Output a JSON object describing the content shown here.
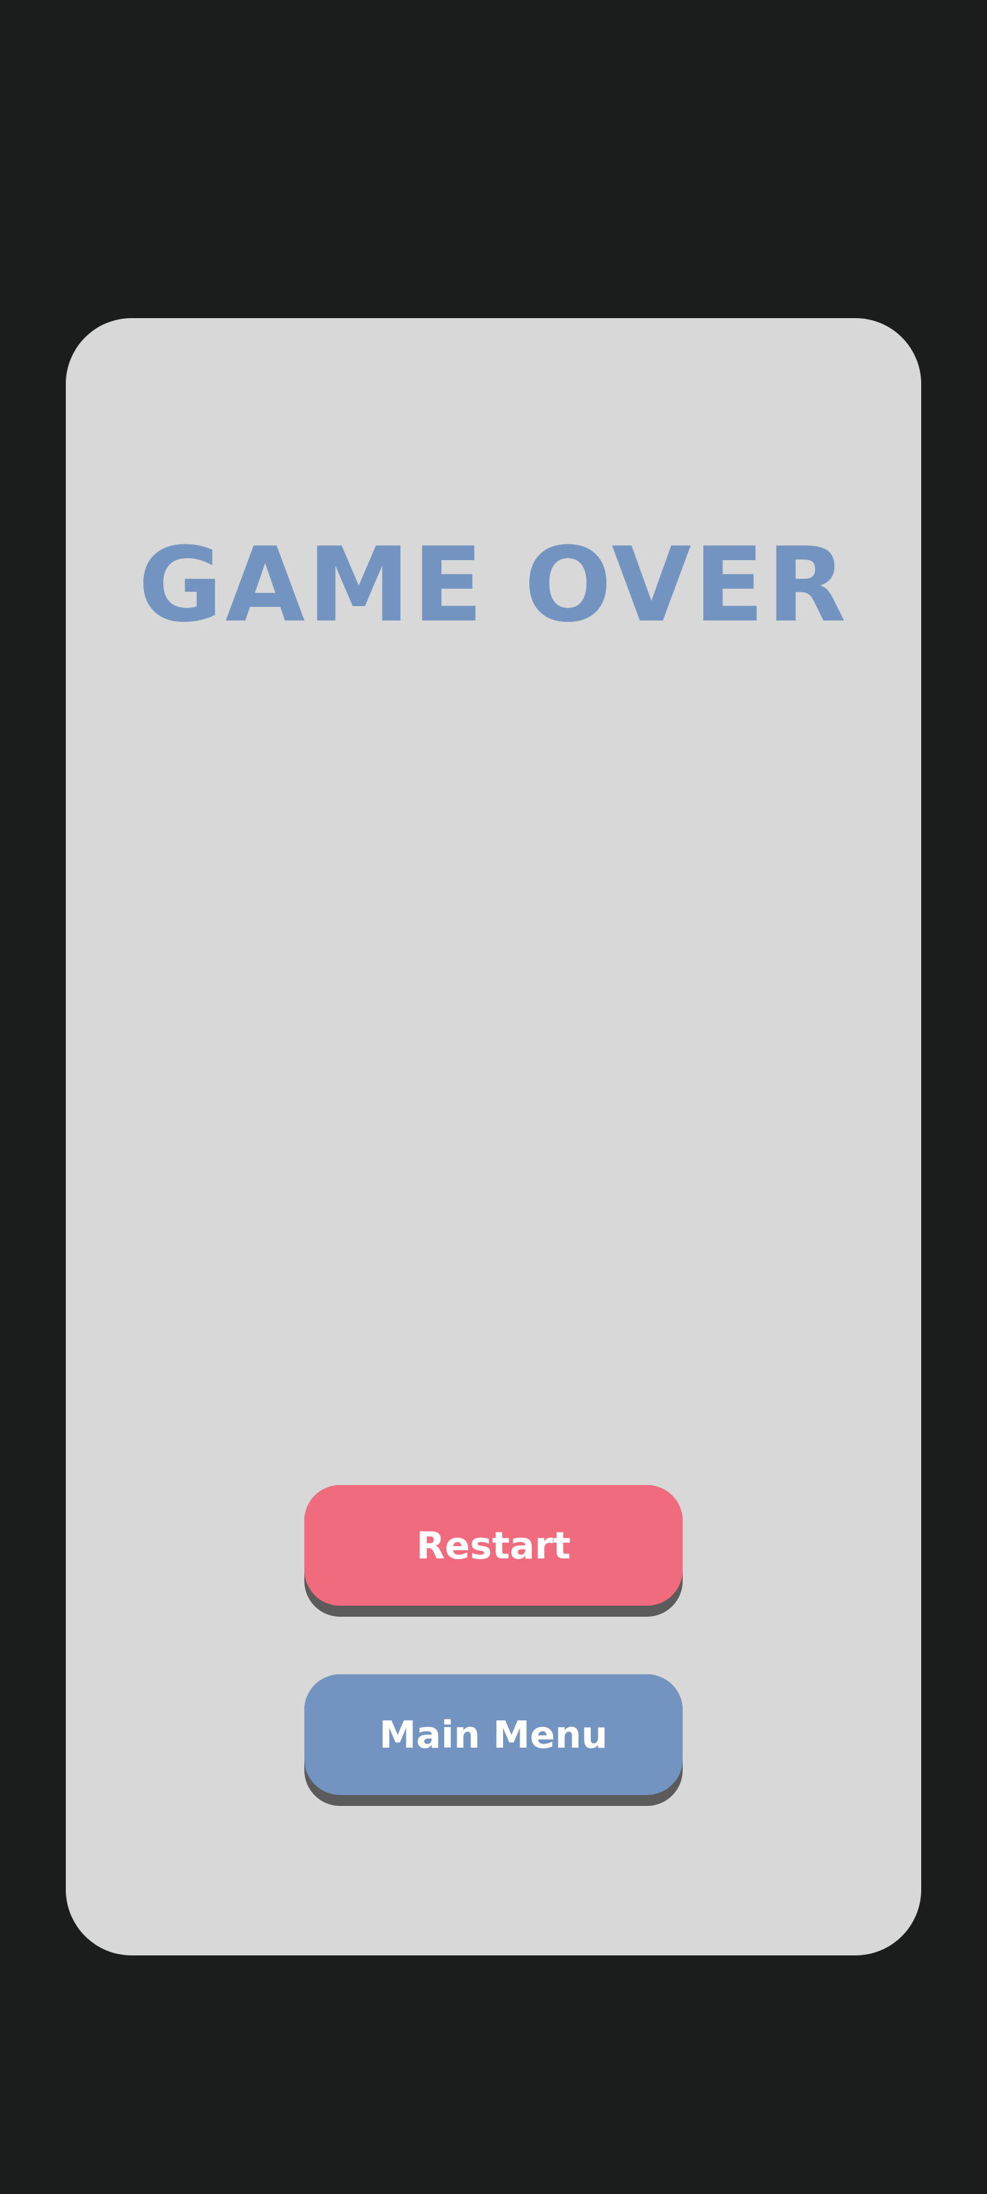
{
  "screen": {
    "title": "GAME OVER"
  },
  "buttons": {
    "restart_label": "Restart",
    "main_menu_label": "Main Menu"
  },
  "colors": {
    "background": "#1b1c1c",
    "panel": "#d8d8d8",
    "title": "#7393c0",
    "restart_button": "#f06b7e",
    "main_menu_button": "#7393c0",
    "button_shadow": "#5b5b5b",
    "button_text": "#ffffff"
  }
}
